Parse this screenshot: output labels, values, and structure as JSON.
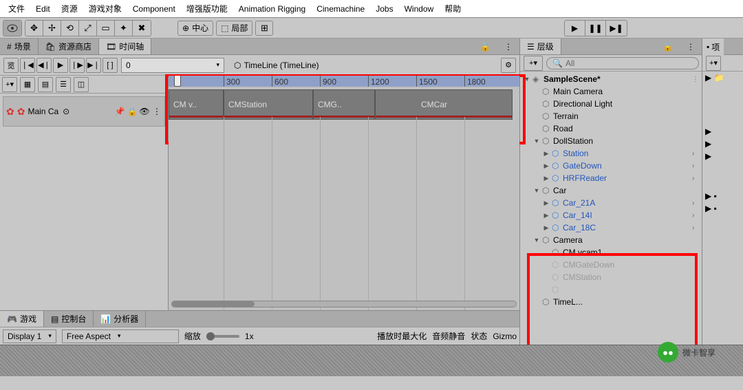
{
  "menu": [
    "文件",
    "Edit",
    "资源",
    "游戏对象",
    "Component",
    "增强版功能",
    "Animation Rigging",
    "Cinemachine",
    "Jobs",
    "Window",
    "帮助"
  ],
  "toolbar": {
    "center": "中心",
    "local": "局部"
  },
  "left_tabs": {
    "scene": "场景",
    "store": "资源商店",
    "timeline": "时间轴"
  },
  "timeline": {
    "frame": "0",
    "asset": "TimeLine (TimeLine)",
    "track": "Main Ca",
    "ruler": [
      "",
      "300",
      "600",
      "900",
      "1200",
      "1500",
      "1800"
    ],
    "clips": [
      "CM v..",
      "CMStation",
      "CMG..",
      "CMCar"
    ]
  },
  "bottom_tabs": {
    "game": "游戏",
    "console": "控制台",
    "profiler": "分析器"
  },
  "bottom": {
    "display": "Display 1",
    "aspect": "Free Aspect",
    "scale_lbl": "缩放",
    "scale_val": "1x",
    "maxplay": "播放时最大化",
    "mute": "音频静音",
    "stats": "状态",
    "gizmos": "Gizmo"
  },
  "hierarchy": {
    "tab": "层级",
    "search_placeholder": "All",
    "nodes": [
      {
        "d": 0,
        "tog": "▼",
        "ico": "unity",
        "label": "SampleScene*",
        "chev": "⋮"
      },
      {
        "d": 1,
        "tog": "",
        "ico": "cube",
        "label": "Main Camera"
      },
      {
        "d": 1,
        "tog": "",
        "ico": "cube",
        "label": "Directional Light"
      },
      {
        "d": 1,
        "tog": "",
        "ico": "cube",
        "label": "Terrain"
      },
      {
        "d": 1,
        "tog": "",
        "ico": "cube",
        "label": "Road"
      },
      {
        "d": 1,
        "tog": "▼",
        "ico": "cube",
        "label": "DollStation"
      },
      {
        "d": 2,
        "tog": "▶",
        "ico": "blue",
        "label": "Station",
        "blue": true,
        "chev": "›"
      },
      {
        "d": 2,
        "tog": "▶",
        "ico": "blue",
        "label": "GateDown",
        "blue": true,
        "chev": "›"
      },
      {
        "d": 2,
        "tog": "▶",
        "ico": "blue",
        "label": "HRFReader",
        "blue": true,
        "chev": "›"
      },
      {
        "d": 1,
        "tog": "▼",
        "ico": "cube",
        "label": "Car"
      },
      {
        "d": 2,
        "tog": "▶",
        "ico": "blue",
        "label": "Car_21A",
        "blue": true,
        "chev": "›"
      },
      {
        "d": 2,
        "tog": "▶",
        "ico": "blue",
        "label": "Car_14I",
        "blue": true,
        "chev": "›"
      },
      {
        "d": 2,
        "tog": "▶",
        "ico": "blue",
        "label": "Car_18C",
        "blue": true,
        "chev": "›"
      },
      {
        "d": 1,
        "tog": "▼",
        "ico": "cube",
        "label": "Camera"
      },
      {
        "d": 2,
        "tog": "",
        "ico": "cube",
        "label": "CM vcam1"
      },
      {
        "d": 2,
        "tog": "",
        "ico": "grey",
        "label": "CMGateDown",
        "grey": true
      },
      {
        "d": 2,
        "tog": "",
        "ico": "grey",
        "label": "CMStation",
        "grey": true
      },
      {
        "d": 2,
        "tog": "",
        "ico": "grey",
        "label": "",
        "grey": true
      },
      {
        "d": 1,
        "tog": "",
        "ico": "cube",
        "label": "TimeL..."
      }
    ]
  },
  "far_right": {
    "tab": "项"
  },
  "watermark": "微卡智享"
}
